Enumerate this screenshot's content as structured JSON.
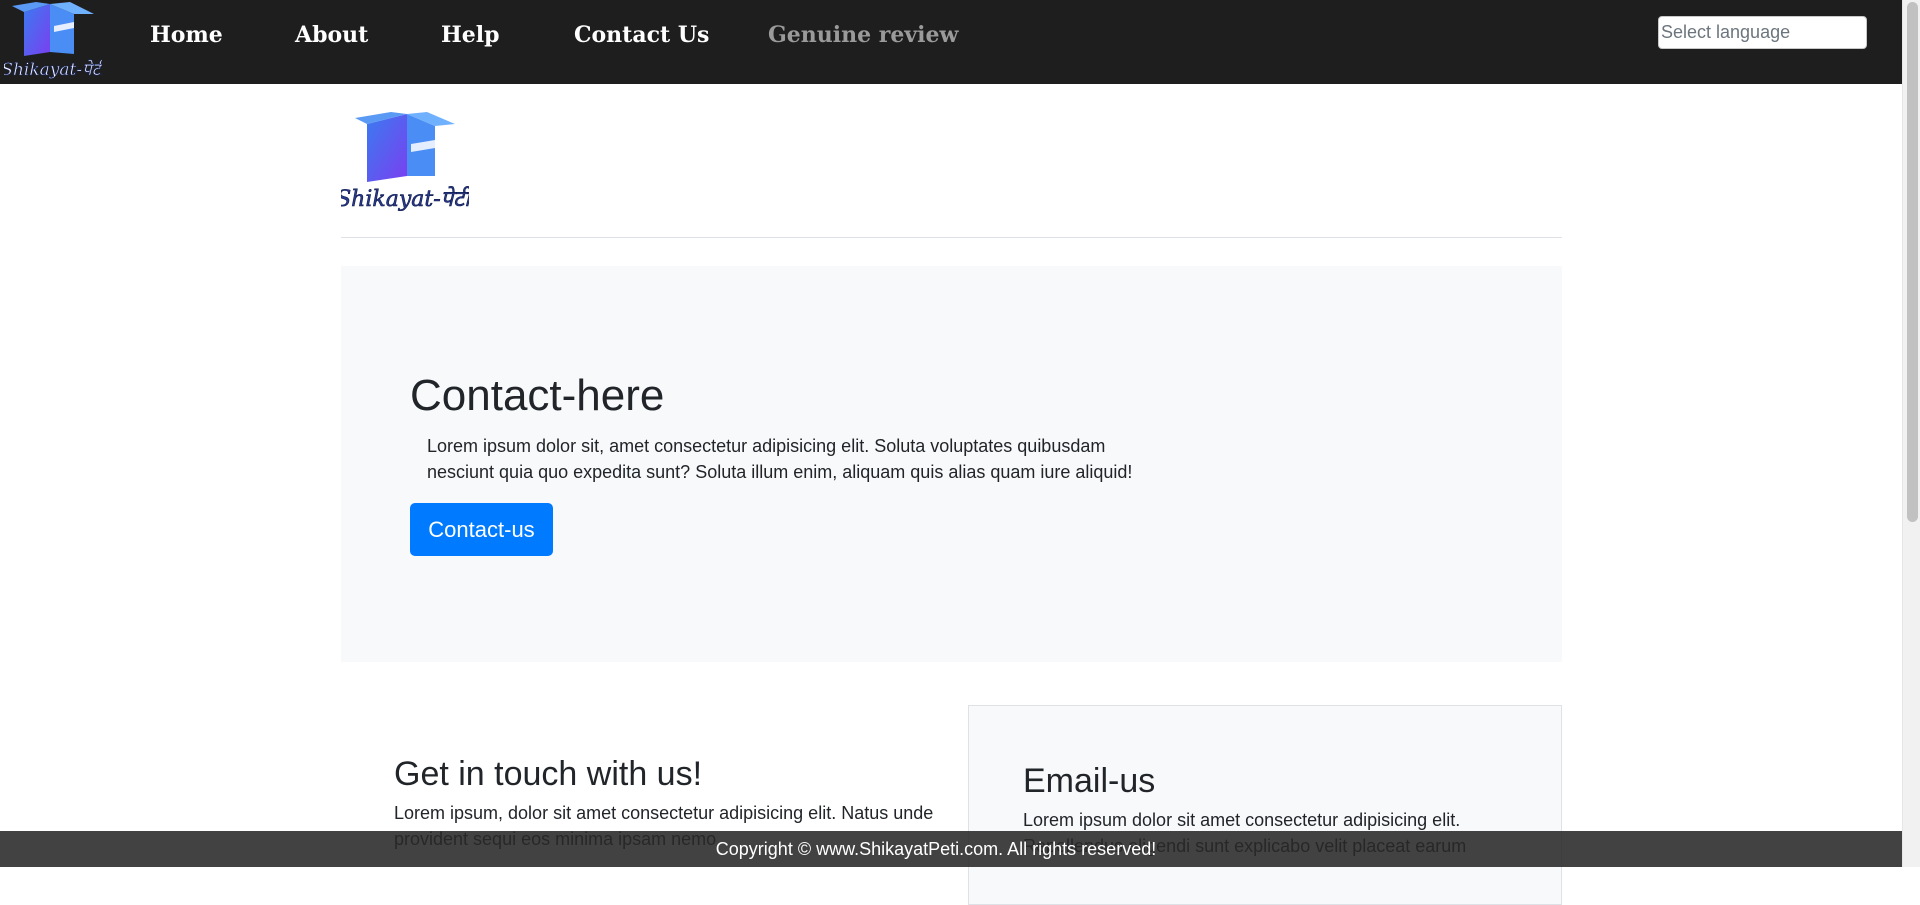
{
  "navbar": {
    "logo_text": "Shikayat-पेटी",
    "links": [
      {
        "label": "Home"
      },
      {
        "label": "About"
      },
      {
        "label": "Help"
      },
      {
        "label": "Contact Us"
      },
      {
        "label": "Genuine review"
      }
    ],
    "language_select": {
      "placeholder": "Select language"
    }
  },
  "page_logo_text": "Shikayat-पेटी",
  "jumbotron": {
    "title": "Contact-here",
    "text": "Lorem ipsum dolor sit, amet consectetur adipisicing elit. Soluta voluptates quibusdam nesciunt quia quo expedita sunt? Soluta illum enim, aliquam quis alias quam iure aliquid!",
    "button_label": "Contact-us"
  },
  "touch": {
    "title": "Get in touch with us!",
    "text": "Lorem ipsum, dolor sit amet consectetur adipisicing elit. Natus unde provident sequi eos minima ipsam nemo"
  },
  "email": {
    "title": "Email-us",
    "text": "Lorem ipsum dolor sit amet consectetur adipisicing elit. Repellendus eligendi sunt explicabo velit placeat earum"
  },
  "footer": {
    "text": "Copyright © www.ShikayatPeti.com. All rights reserved!"
  },
  "colors": {
    "navbar_bg": "#1e1e1e",
    "primary_button": "#007bff",
    "jumbotron_bg": "#f8f9fa",
    "logo_gradient_start": "#3d6ff0",
    "logo_gradient_end": "#7b3ff2"
  }
}
